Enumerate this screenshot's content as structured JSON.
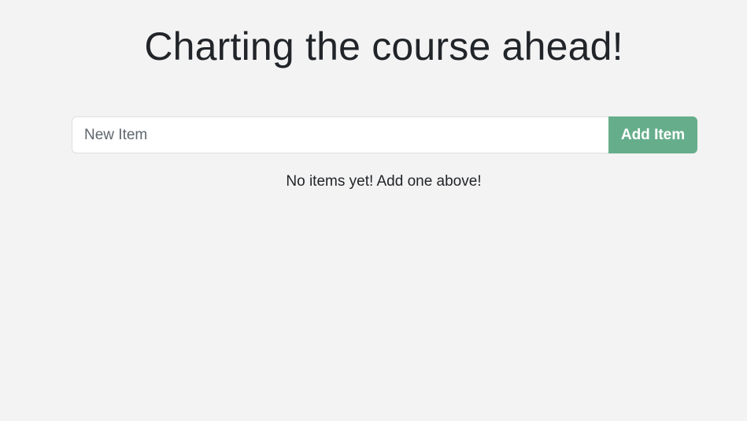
{
  "header": {
    "title": "Charting the course ahead!"
  },
  "add_form": {
    "input_placeholder": "New Item",
    "input_value": "",
    "button_label": "Add Item"
  },
  "item_list": {
    "empty_message": "No items yet! Add one above!",
    "items": []
  },
  "colors": {
    "background": "#f3f3f3",
    "button": "#66ae8b",
    "text": "#212529"
  }
}
